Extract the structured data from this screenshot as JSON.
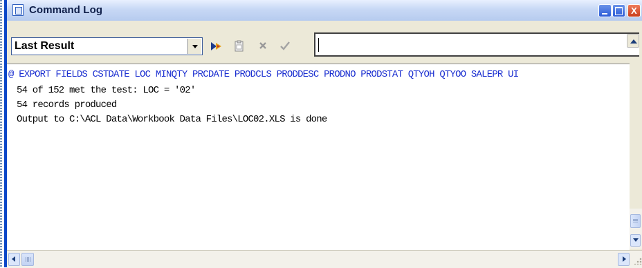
{
  "window": {
    "title": "Command Log",
    "controls": {
      "minimize": "",
      "maximize": "",
      "close": "X"
    }
  },
  "toolbar": {
    "result_select": "Last Result",
    "icons": [
      "run-icon",
      "copy-icon",
      "clear-icon",
      "accept-icon"
    ],
    "command_input_value": ""
  },
  "log": {
    "lines": [
      "@ EXPORT FIELDS CSTDATE LOC MINQTY PRCDATE PRODCLS PRODDESC PRODNO PRODSTAT QTYOH QTYOO SALEPR UI",
      "54 of 152 met the test: LOC = '02'",
      "54 records produced",
      "Output to C:\\ACL Data\\Workbook Data Files\\LOC02.XLS is done"
    ]
  },
  "colors": {
    "title_bar": "#c7d8f5",
    "window_border": "#0b46c8",
    "command_text": "#1a2ed0",
    "output_text": "#000000",
    "chrome": "#ece9d8"
  }
}
